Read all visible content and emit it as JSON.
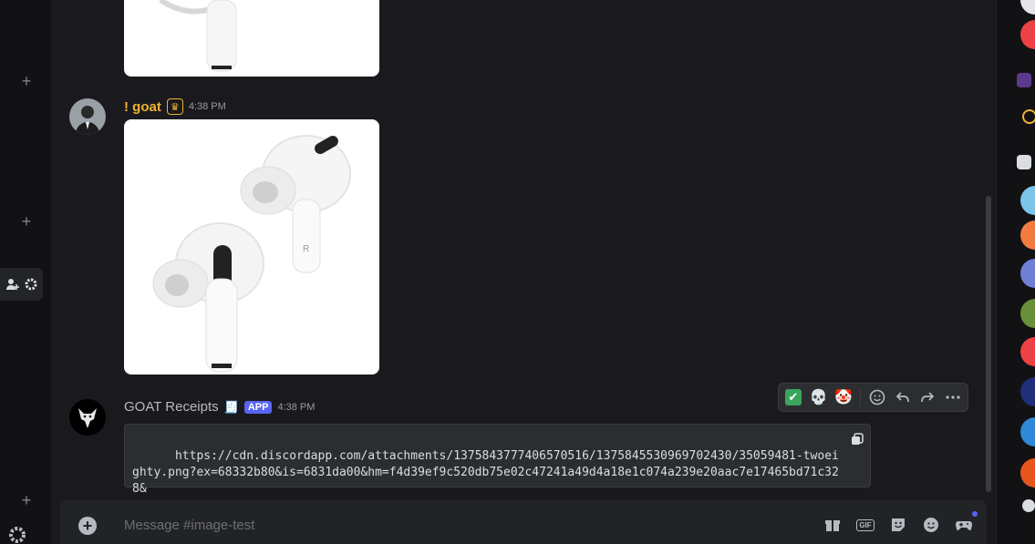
{
  "messages": [
    {
      "username": "! goat",
      "username_color": "#f0b132",
      "badge_icon": "crown-icon",
      "timestamp": "4:38 PM",
      "attachment": "airpods-pro-image"
    },
    {
      "username": "GOAT Receipts",
      "username_color": "#b5bac1",
      "badge": "APP",
      "timestamp": "4:38 PM",
      "code": "https://cdn.discordapp.com/attachments/1375843777406570516/1375845530969702430/35059481-twoeighty.png?ex=68332b80&is=6831da00&hm=f4d39ef9c520db75e02c47241a49d4a18e1c074a239e20aac7e17465bd71c328&"
    }
  ],
  "composer": {
    "placeholder": "Message #image-test"
  },
  "reactions": [
    "check-icon",
    "skull-icon",
    "clown-icon"
  ],
  "icons": {
    "add": "plus-icon",
    "members": "add-member-icon",
    "settings": "gear-icon",
    "copy": "copy-icon",
    "gift": "gift-icon",
    "gif": "GIF",
    "sticker": "sticker-icon",
    "emoji": "emoji-icon",
    "activity": "gamepad-icon"
  },
  "colors": {
    "background": "#1a1a1e",
    "sidebar": "#121214",
    "accent": "#5865f2",
    "server_red": "#ed4245"
  }
}
